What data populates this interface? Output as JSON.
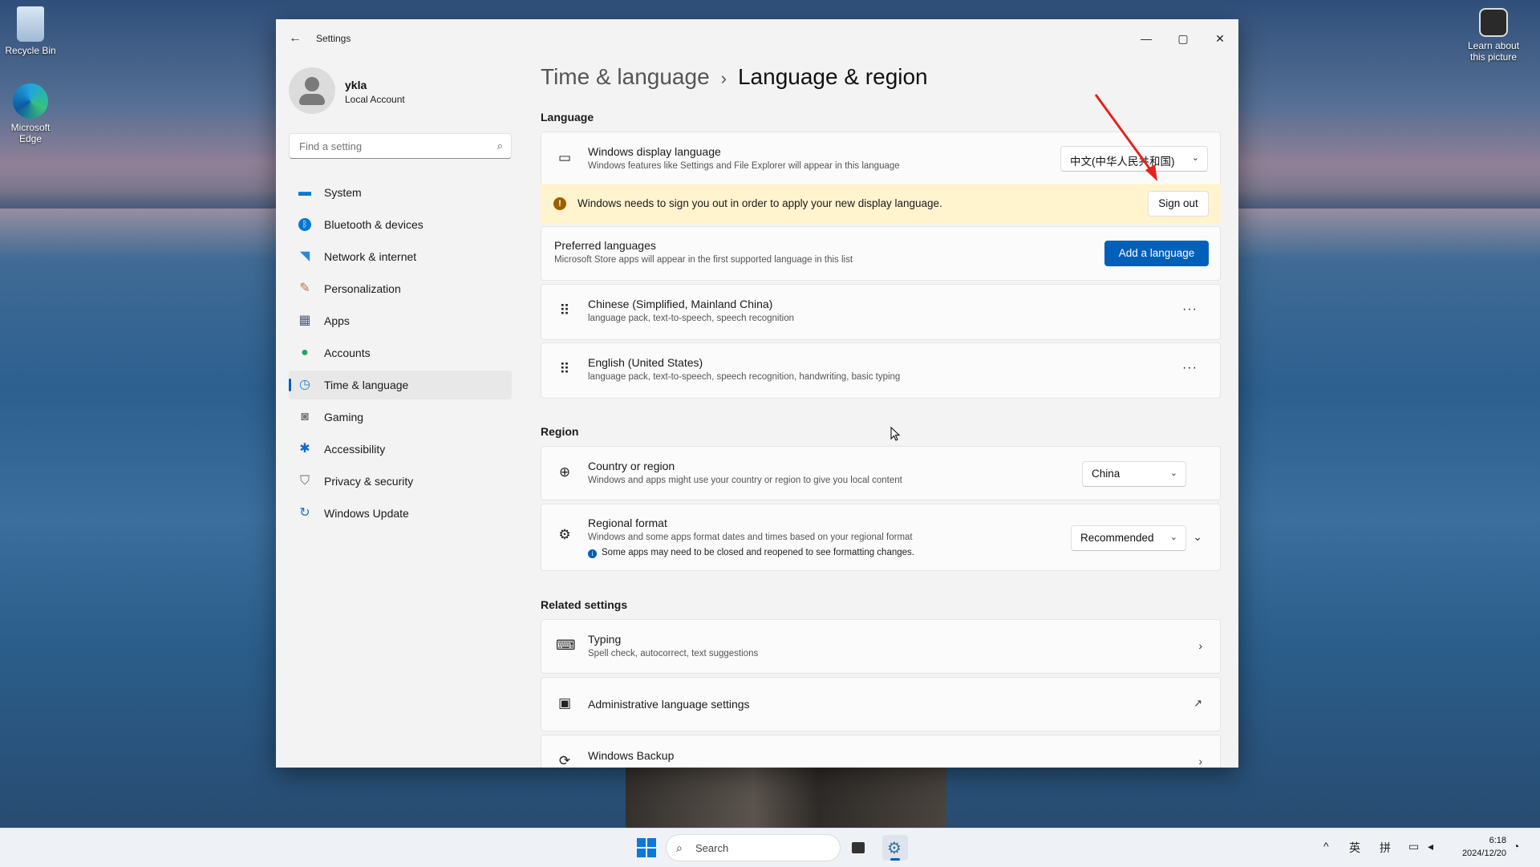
{
  "desktop": {
    "icons": [
      {
        "label": "Recycle Bin"
      },
      {
        "label": "Microsoft Edge"
      },
      {
        "label": "Learn about this picture"
      }
    ]
  },
  "window": {
    "title": "Settings",
    "controls": {
      "minimize": "—",
      "maximize": "▢",
      "close": "✕"
    }
  },
  "profile": {
    "name": "ykla",
    "account_type": "Local Account"
  },
  "search": {
    "placeholder": "Find a setting"
  },
  "nav": {
    "items": [
      {
        "label": "System",
        "icon": "monitor-icon",
        "color": "#0078d4"
      },
      {
        "label": "Bluetooth & devices",
        "icon": "bluetooth-icon",
        "color": "#0078d4"
      },
      {
        "label": "Network & internet",
        "icon": "wifi-icon",
        "color": "#2b88d8"
      },
      {
        "label": "Personalization",
        "icon": "brush-icon",
        "color": "#c46c3b"
      },
      {
        "label": "Apps",
        "icon": "apps-icon",
        "color": "#4a5c7a"
      },
      {
        "label": "Accounts",
        "icon": "person-icon",
        "color": "#21a56a"
      },
      {
        "label": "Time & language",
        "icon": "globe-clock-icon",
        "color": "#1e7fd0",
        "active": true
      },
      {
        "label": "Gaming",
        "icon": "gamepad-icon",
        "color": "#7a7a7a"
      },
      {
        "label": "Accessibility",
        "icon": "accessibility-icon",
        "color": "#1666c5"
      },
      {
        "label": "Privacy & security",
        "icon": "shield-icon",
        "color": "#6b6b6b"
      },
      {
        "label": "Windows Update",
        "icon": "update-icon",
        "color": "#1a73c9"
      }
    ]
  },
  "breadcrumb": {
    "parent": "Time & language",
    "separator": "›",
    "current": "Language & region"
  },
  "language": {
    "section_title": "Language",
    "display": {
      "title": "Windows display language",
      "subtitle": "Windows features like Settings and File Explorer will appear in this language",
      "value": "中文(中华人民共和国)"
    },
    "banner": {
      "text": "Windows needs to sign you out in order to apply your new display language.",
      "button": "Sign out"
    },
    "preferred": {
      "title": "Preferred languages",
      "subtitle": "Microsoft Store apps will appear in the first supported language in this list",
      "button": "Add a language"
    },
    "list": [
      {
        "title": "Chinese (Simplified, Mainland China)",
        "subtitle": "language pack, text-to-speech, speech recognition"
      },
      {
        "title": "English (United States)",
        "subtitle": "language pack, text-to-speech, speech recognition, handwriting, basic typing"
      }
    ]
  },
  "region": {
    "section_title": "Region",
    "country": {
      "title": "Country or region",
      "subtitle": "Windows and apps might use your country or region to give you local content",
      "value": "China"
    },
    "format": {
      "title": "Regional format",
      "subtitle": "Windows and some apps format dates and times based on your regional format",
      "note": "Some apps may need to be closed and reopened to see formatting changes.",
      "value": "Recommended"
    }
  },
  "related": {
    "section_title": "Related settings",
    "items": [
      {
        "title": "Typing",
        "subtitle": "Spell check, autocorrect, text suggestions"
      },
      {
        "title": "Administrative language settings"
      },
      {
        "title": "Windows Backup"
      }
    ]
  },
  "taskbar": {
    "search_label": "Search",
    "tray": {
      "ime1": "英",
      "ime2": "拼"
    },
    "time": "6:18",
    "date": "2024/12/20"
  },
  "colors": {
    "accent": "#005fb8",
    "banner_bg": "#fff4ce",
    "annotation_arrow": "#e8221a"
  }
}
